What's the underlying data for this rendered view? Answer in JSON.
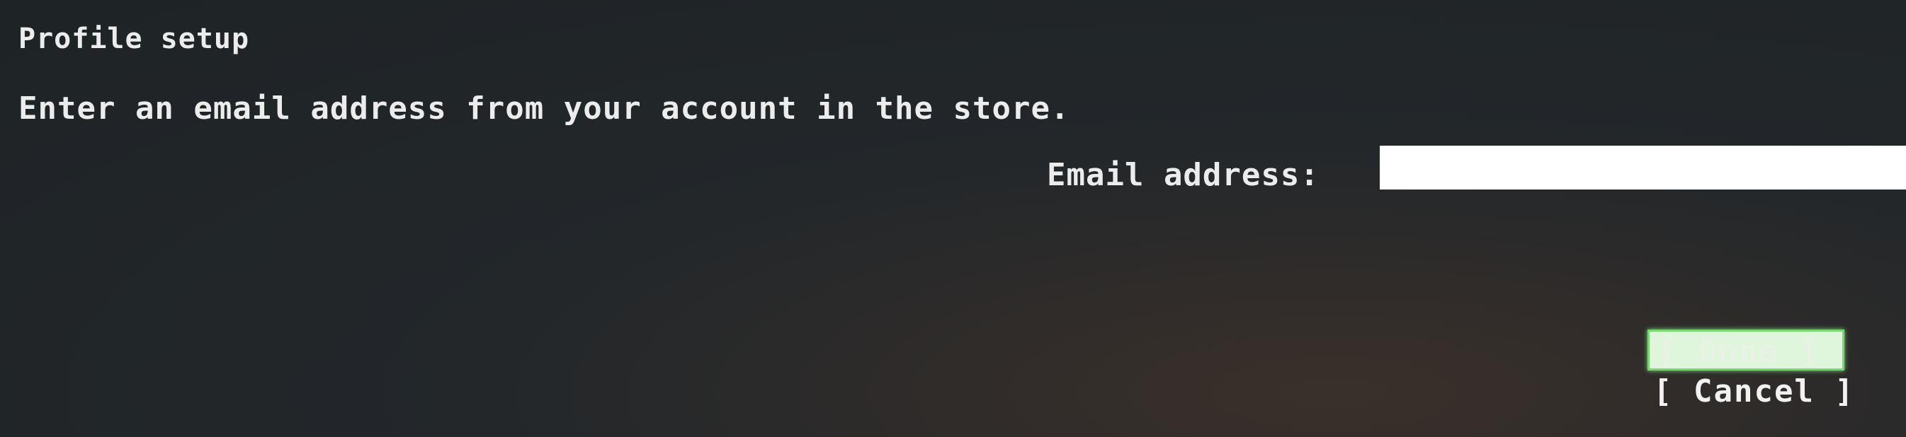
{
  "dialog": {
    "title": "Profile setup",
    "instruction": "Enter an email address from your account in the store.",
    "email_label": "Email address:",
    "email_value": ""
  },
  "buttons": {
    "done_label": "[ Done ]",
    "cancel_label": "[ Cancel ]"
  },
  "colors": {
    "background": "#23272a",
    "text": "#ececec",
    "focus_highlight": "#77d873",
    "input_background": "#ffffff"
  }
}
